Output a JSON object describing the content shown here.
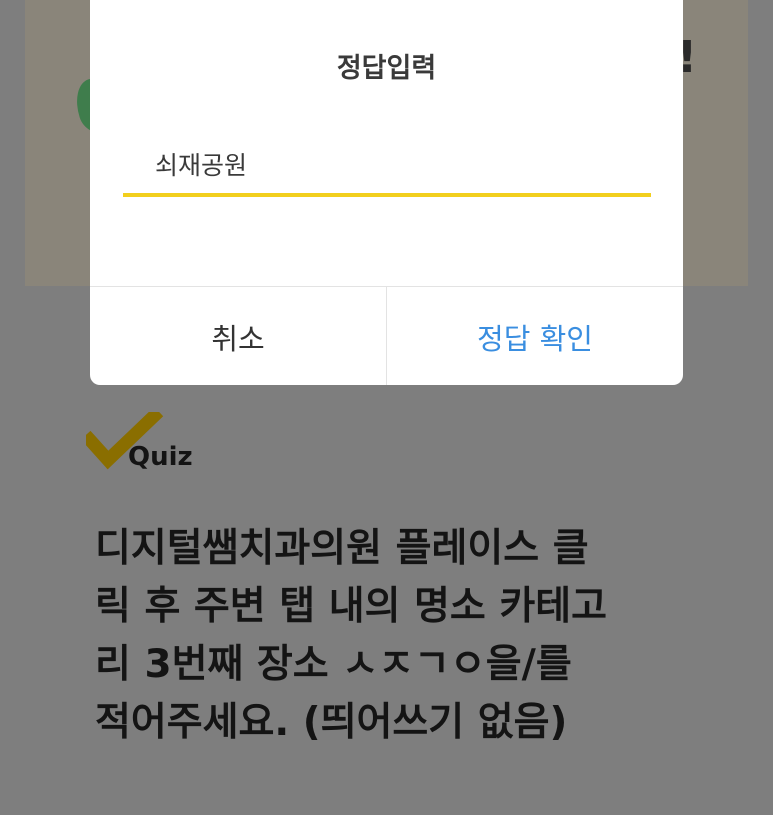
{
  "dialog": {
    "title": "정답입력",
    "input_value": "쇠재공원",
    "cancel_label": "취소",
    "confirm_label": "정답 확인"
  },
  "banner": {
    "exclamation": "!"
  },
  "quiz": {
    "label": "Quiz",
    "question_lines": [
      "디지털쌤치과의원 플레이스 클",
      "릭 후 주변 탭 내의 명소 카테고",
      "리 3번째 장소 ㅅㅈㄱㅇ을/를",
      "적어주세요. (띄어쓰기 없음)"
    ]
  },
  "colors": {
    "accent_underline": "#f2cf1d",
    "confirm_text": "#3a8ee0",
    "checkmark": "#8a6e00",
    "overlay_background": "#7e7e7e"
  },
  "icons": {
    "checkmark": "checkmark-icon"
  }
}
